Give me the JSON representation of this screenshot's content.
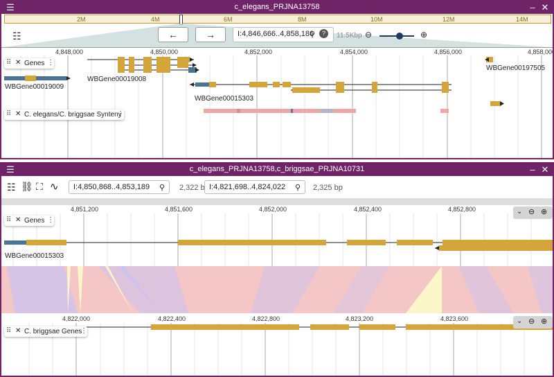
{
  "view1": {
    "title": "c_elegans_PRJNA13758",
    "overview_ticks": [
      "2M",
      "4M",
      "6M",
      "8M",
      "10M",
      "12M",
      "14M"
    ],
    "nav_back_icon": "arrow-left-icon",
    "nav_forward_icon": "arrow-right-icon",
    "locstring": "I:4,846,666..4,858,186",
    "bp_label": "11.5Kbp",
    "zoom_level": 0.6,
    "ruler_ticks": [
      "4,848,000",
      "4,850,000",
      "4,852,000",
      "4,854,000",
      "4,856,000",
      "4,858,000"
    ],
    "tracks": [
      {
        "name": "Genes"
      },
      {
        "name": "C. elegans/C. briggsae Synteny"
      }
    ],
    "gene_labels": [
      "WBGene00019008",
      "WBGene00019009",
      "WBGene00015303",
      "WBGene00197505"
    ]
  },
  "view2": {
    "title": "c_elegans_PRJNA13758,c_briggsae_PRJNA10731",
    "top_locstring": "I:4,850,868..4,853,189",
    "top_bp": "2,322 bp",
    "bottom_locstring": "I:4,821,698..4,824,022",
    "bottom_bp": "2,325 bp",
    "top_ruler_ticks": [
      "4,851,200",
      "4,851,600",
      "4,852,000",
      "4,852,400",
      "4,852,800"
    ],
    "top_track": {
      "name": "Genes"
    },
    "top_gene_label": "WBGene00015303",
    "bottom_ruler_ticks": [
      "4,822,000",
      "4,822,400",
      "4,822,800",
      "4,823,200",
      "4,823,600"
    ],
    "bottom_track": {
      "name": "C. briggsae Genes"
    }
  },
  "colors": {
    "frame": "#6e2467",
    "gene": "#d3a53a",
    "utr": "#4a7394",
    "synteny": "#f5c6c6",
    "synteny_blue": "#c7c3f2",
    "synteny_yellow": "#fbf7c8"
  }
}
